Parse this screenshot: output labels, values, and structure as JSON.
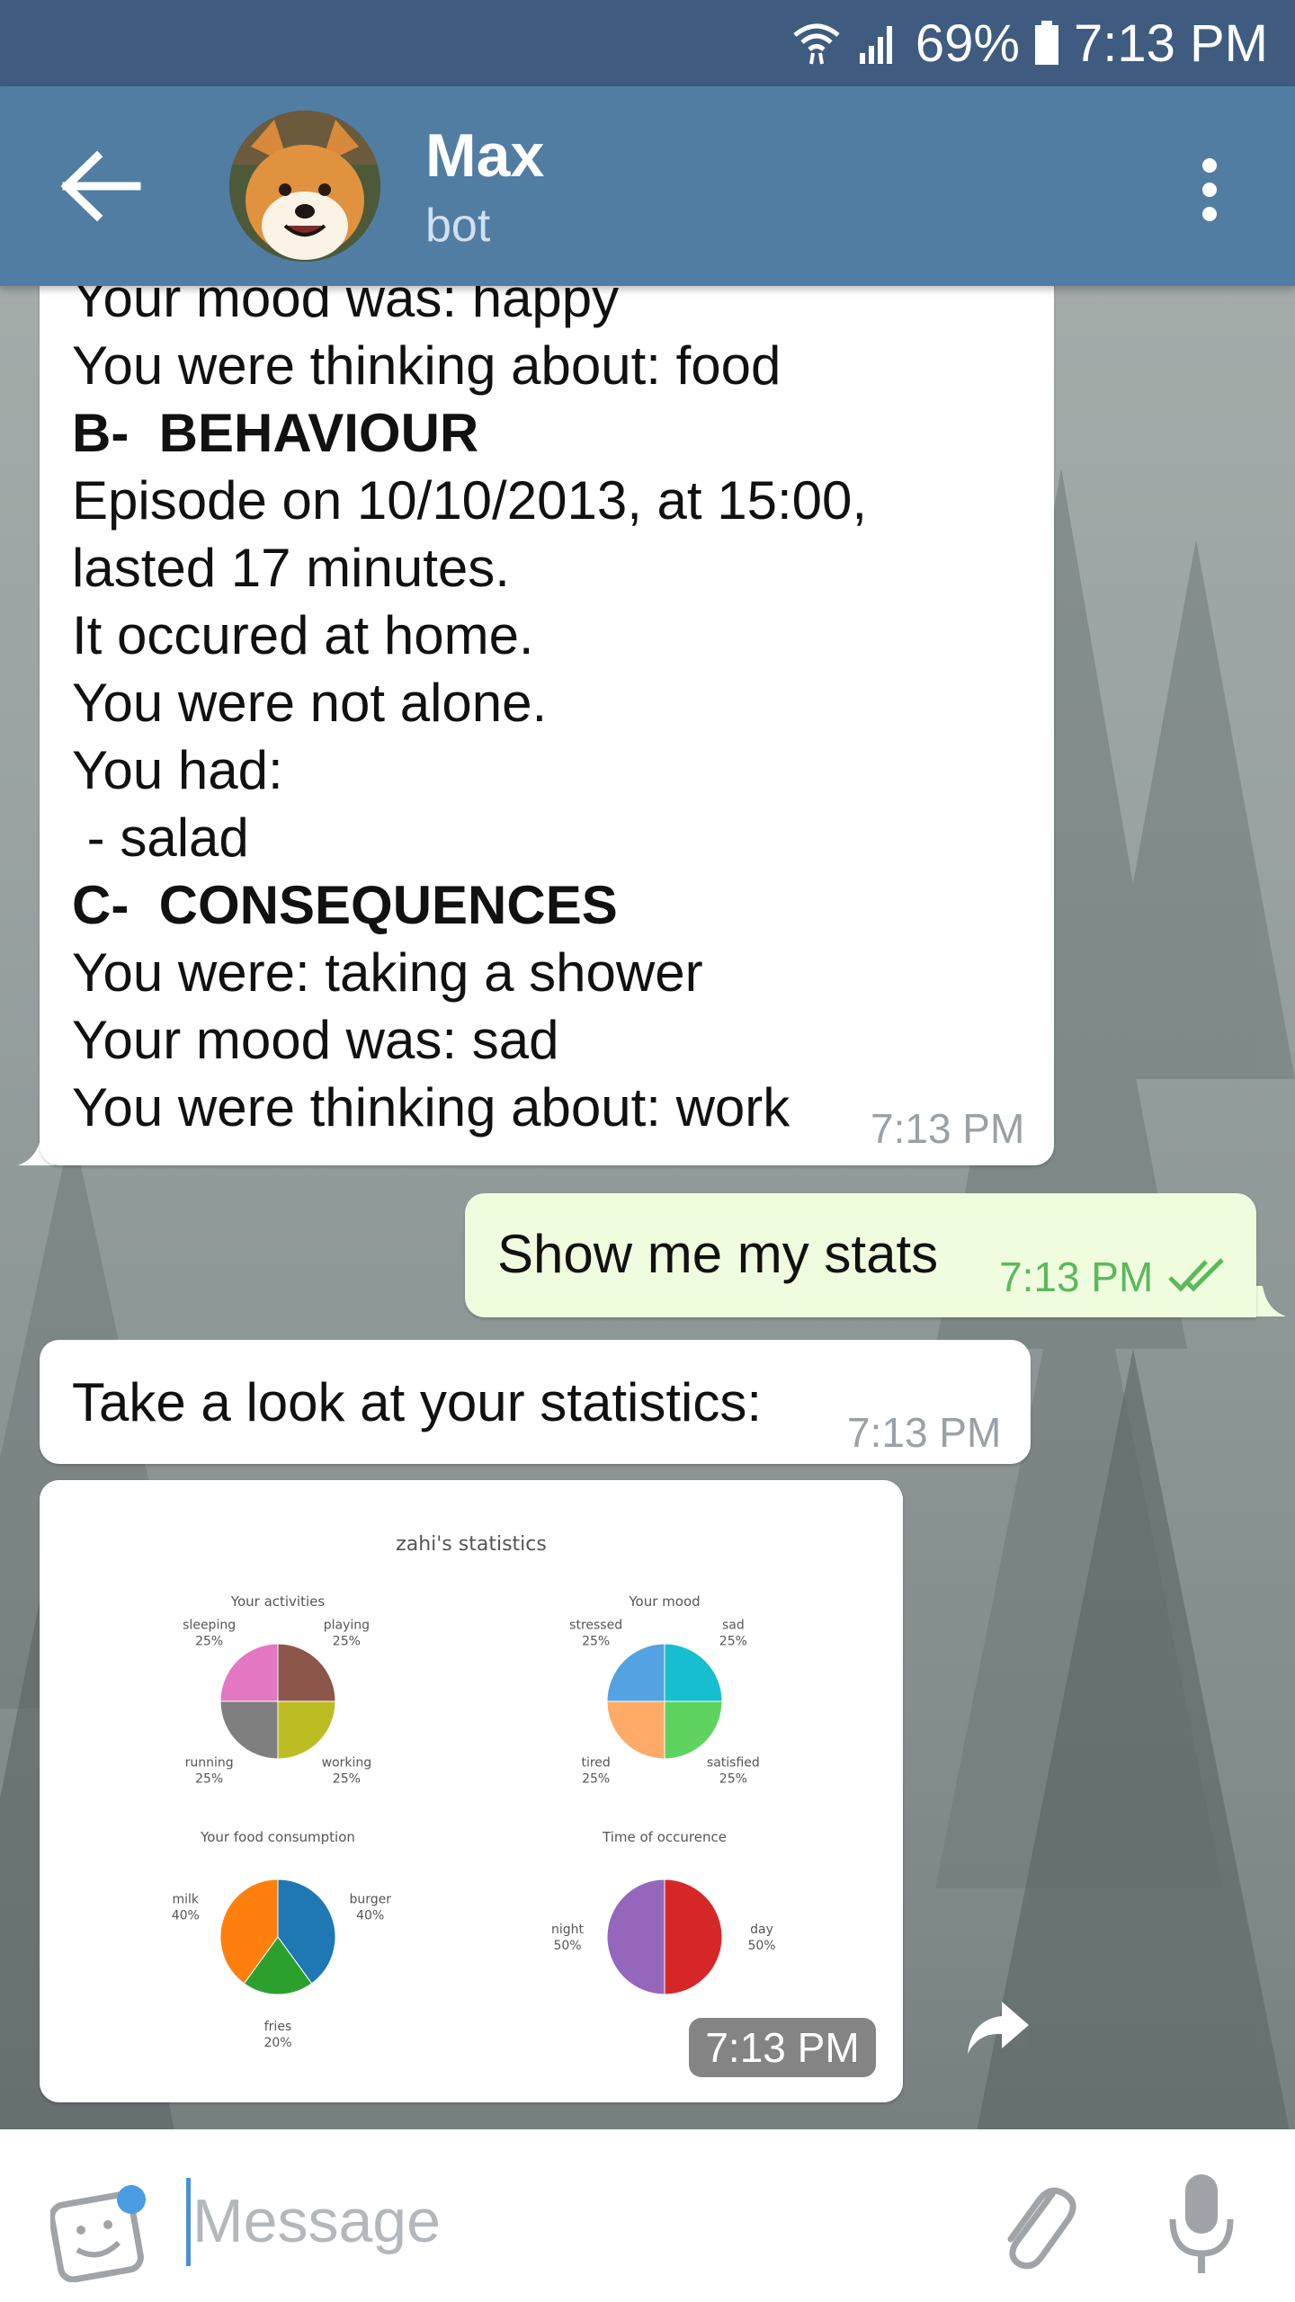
{
  "status_bar": {
    "battery": "69%",
    "time": "7:13 PM"
  },
  "header": {
    "title": "Max",
    "subtitle": "bot"
  },
  "messages": [
    {
      "type": "in",
      "lines": [
        {
          "text": "Your mood was: happy",
          "bold": false
        },
        {
          "text": "You were thinking about: food",
          "bold": false
        },
        {
          "text": "B-  BEHAVIOUR",
          "bold": true
        },
        {
          "text": "Episode on 10/10/2013, at 15:00,",
          "bold": false
        },
        {
          "text": "lasted 17 minutes.",
          "bold": false
        },
        {
          "text": "It occured at home.",
          "bold": false
        },
        {
          "text": "You were not alone.",
          "bold": false
        },
        {
          "text": "You had:",
          "bold": false
        },
        {
          "text": " - salad",
          "bold": false
        },
        {
          "text": "C-  CONSEQUENCES",
          "bold": true
        },
        {
          "text": "You were: taking a shower",
          "bold": false
        },
        {
          "text": "Your mood was: sad",
          "bold": false
        },
        {
          "text": "You were thinking about: work",
          "bold": false
        }
      ],
      "time": "7:13 PM"
    },
    {
      "type": "out",
      "text": "Show me my stats",
      "time": "7:13 PM"
    },
    {
      "type": "in",
      "text": "Take a look at your statistics:",
      "time": "7:13 PM"
    },
    {
      "type": "image",
      "time": "7:13 PM"
    }
  ],
  "stats_image": {
    "title": "zahi's statistics",
    "charts": [
      {
        "type": "pie",
        "title": "Your activities",
        "slices": [
          {
            "label": "playing",
            "value": 25,
            "pct": "25%",
            "color": "#8c564b"
          },
          {
            "label": "working",
            "value": 25,
            "pct": "25%",
            "color": "#bcbd22"
          },
          {
            "label": "running",
            "value": 25,
            "pct": "25%",
            "color": "#7f7f7f"
          },
          {
            "label": "sleeping",
            "value": 25,
            "pct": "25%",
            "color": "#e377c2"
          }
        ]
      },
      {
        "type": "pie",
        "title": "Your mood",
        "slices": [
          {
            "label": "sad",
            "value": 25,
            "pct": "25%",
            "color": "#17becf"
          },
          {
            "label": "satisfied",
            "value": 25,
            "pct": "25%",
            "color": "#5fd35f"
          },
          {
            "label": "tired",
            "value": 25,
            "pct": "25%",
            "color": "#ffaa66"
          },
          {
            "label": "stressed",
            "value": 25,
            "pct": "25%",
            "color": "#55a2e2"
          }
        ]
      },
      {
        "type": "pie",
        "title": "Your food consumption",
        "slices": [
          {
            "label": "burger",
            "value": 40,
            "pct": "40%",
            "color": "#1f77b4"
          },
          {
            "label": "fries",
            "value": 20,
            "pct": "20%",
            "color": "#2ca02c"
          },
          {
            "label": "milk",
            "value": 40,
            "pct": "40%",
            "color": "#ff7f0e"
          }
        ]
      },
      {
        "type": "pie",
        "title": "Time of occurence",
        "slices": [
          {
            "label": "day",
            "value": 50,
            "pct": "50%",
            "color": "#d62728"
          },
          {
            "label": "night",
            "value": 50,
            "pct": "50%",
            "color": "#9467bd"
          }
        ]
      }
    ]
  },
  "input": {
    "placeholder": "Message"
  },
  "icons": {
    "wifi": "wifi-icon",
    "signal": "signal-icon",
    "battery": "battery-icon",
    "back": "arrow-left-icon",
    "menu": "more-vertical-icon",
    "read": "double-check-icon",
    "share": "share-icon",
    "sticker": "sticker-icon",
    "attach": "paperclip-icon",
    "mic": "microphone-icon"
  },
  "colors": {
    "header": "#527da3",
    "status_bar": "#3f5c80",
    "outgoing_bubble": "#effdde",
    "outgoing_time": "#5cb85c",
    "accent": "#4a90d9"
  }
}
